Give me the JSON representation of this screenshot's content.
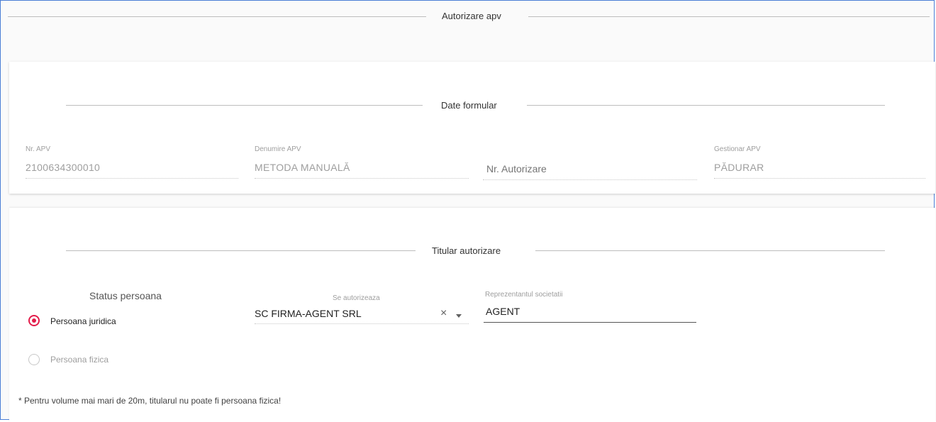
{
  "section_title": "Autorizare apv",
  "form_data": {
    "title": "Date formular",
    "fields": [
      {
        "label": "Nr. APV",
        "value": "2100634300010"
      },
      {
        "label": "Denumire APV",
        "value": "METODA MANUALĂ"
      },
      {
        "label": "",
        "placeholder": "Nr. Autorizare"
      },
      {
        "label": "Gestionar APV",
        "value": "PĂDURAR"
      }
    ]
  },
  "holder": {
    "title": "Titular autorizare",
    "status_title": "Status persoana",
    "radio_options": [
      {
        "label": "Persoana juridica",
        "checked": true
      },
      {
        "label": "Persoana fizica",
        "checked": false
      }
    ],
    "select": {
      "label": "Se autorizeaza",
      "value": "SC FIRMA-AGENT SRL"
    },
    "representative": {
      "label": "Reprezentantul societatii",
      "value": "AGENT"
    },
    "note": "* Pentru volume mai mari de 20m, titularul nu poate fi persoana fizica!"
  },
  "colors": {
    "accent": "#e31c4a",
    "frame_border": "#4a7ed6"
  }
}
